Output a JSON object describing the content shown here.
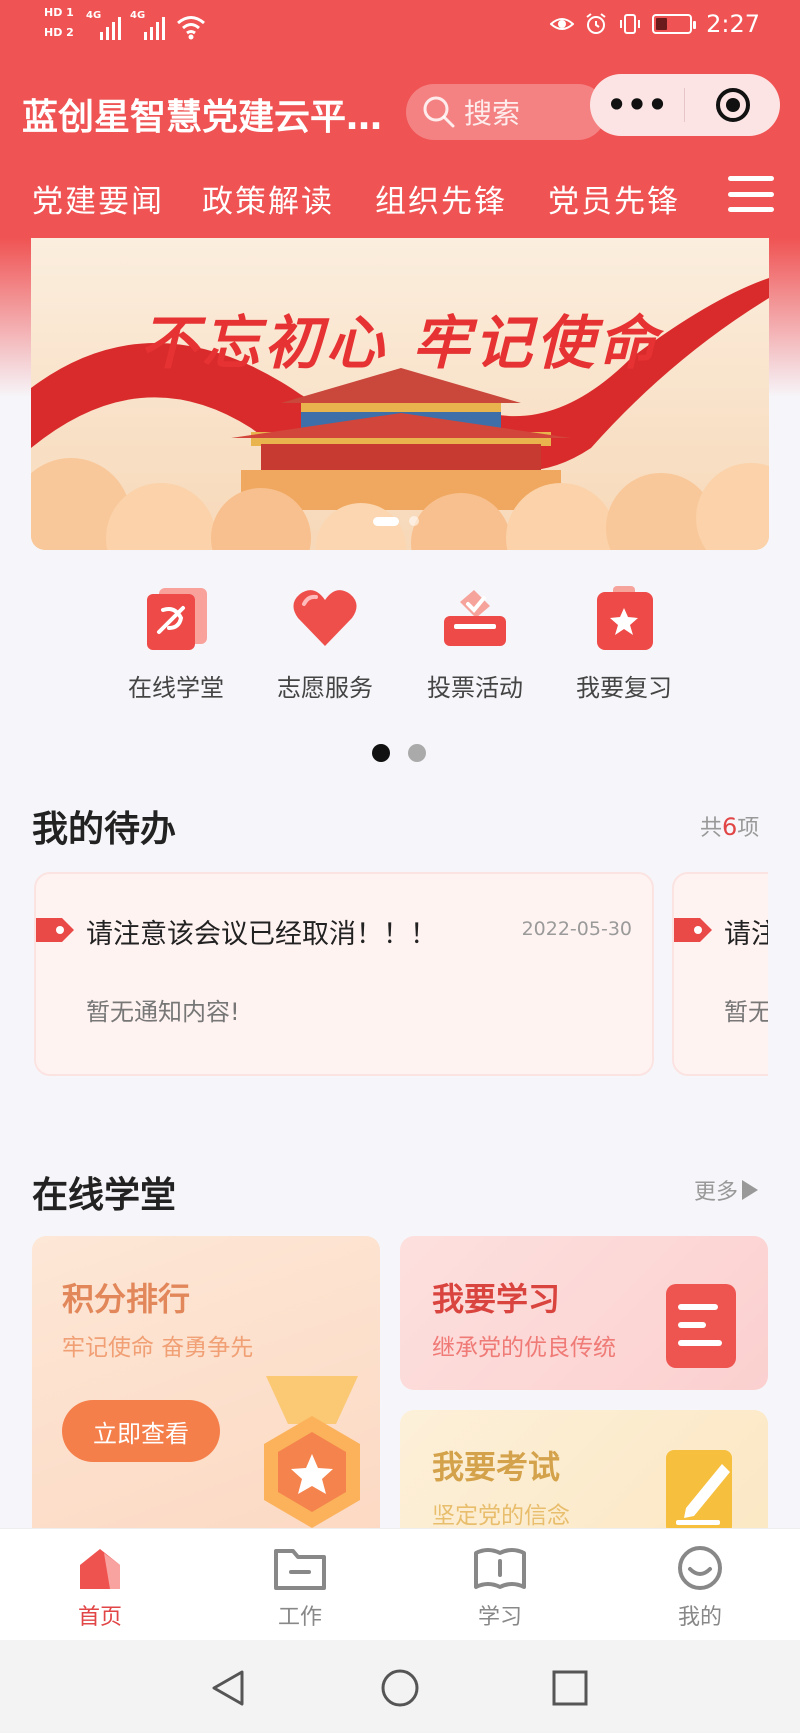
{
  "status_bar": {
    "hd1": "HD 1",
    "hd2": "HD 2",
    "net1": "4G",
    "net2": "4G",
    "time": "2:27",
    "battery_level": 0.35,
    "icons": [
      "eye-icon",
      "alarm-icon",
      "vibrate-icon",
      "battery-icon"
    ]
  },
  "header": {
    "title": "蓝创星智慧党建云平…",
    "search_placeholder": "搜索",
    "capsule_more": "•••",
    "accent_color": "#f05353"
  },
  "nav_tabs": [
    "党建要闻",
    "政策解读",
    "组织先锋",
    "党员先锋"
  ],
  "banner": {
    "slogan": "不忘初心 牢记使命",
    "active_slide": 1,
    "slide_count": 2
  },
  "quick_entries": [
    {
      "label": "在线学堂",
      "icon": "party-book-icon"
    },
    {
      "label": "志愿服务",
      "icon": "heart-icon"
    },
    {
      "label": "投票活动",
      "icon": "ballot-box-icon"
    },
    {
      "label": "我要复习",
      "icon": "star-clipboard-icon"
    }
  ],
  "quick_page": {
    "active": 1,
    "count": 2
  },
  "todo": {
    "title": "我的待办",
    "count_prefix": "共",
    "count": "6",
    "count_suffix": "项",
    "items": [
      {
        "title": "请注意该会议已经取消！！！",
        "date": "2022-05-30",
        "content": "暂无通知内容!"
      },
      {
        "title": "请注",
        "date": "",
        "content": "暂无"
      }
    ]
  },
  "school": {
    "title": "在线学堂",
    "more": "更多",
    "ranking": {
      "title": "积分排行",
      "subtitle": "牢记使命 奋勇争先",
      "button": "立即查看"
    },
    "study": {
      "title": "我要学习",
      "subtitle": "继承党的优良传统"
    },
    "exam": {
      "title": "我要考试",
      "subtitle": "坚定党的信念"
    }
  },
  "tabbar": [
    {
      "label": "首页",
      "icon": "home-icon",
      "active": true
    },
    {
      "label": "工作",
      "icon": "folder-icon",
      "active": false
    },
    {
      "label": "学习",
      "icon": "book-icon",
      "active": false
    },
    {
      "label": "我的",
      "icon": "profile-icon",
      "active": false
    }
  ],
  "tabbar_colors": {
    "active": "#e14545",
    "inactive": "#888888"
  }
}
